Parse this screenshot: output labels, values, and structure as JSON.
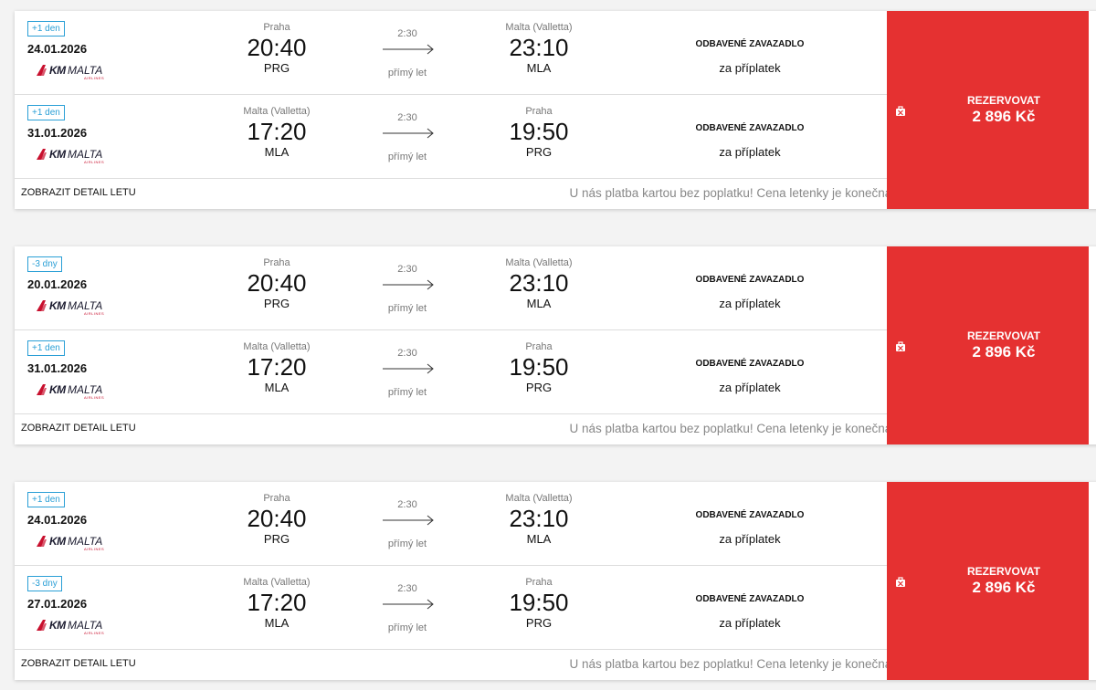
{
  "footer": {
    "detail_link": "ZOBRAZIT DETAIL LETU",
    "payment_note": "U nás platba kartou bez poplatku! Cena letenky je konečná."
  },
  "book": {
    "label": "REZERVOVAT"
  },
  "airline": {
    "brand_bold": "KM",
    "brand_regular": "MALTA",
    "brand_sub": "AIRLINES"
  },
  "colors": {
    "accent_red": "#e53131",
    "badge_blue": "#2a9fd6"
  },
  "results": [
    {
      "price": "2 896 Kč",
      "legs": [
        {
          "badge": "+1 den",
          "date": "24.01.2026",
          "dep_city": "Praha",
          "dep_time": "20:40",
          "dep_code": "PRG",
          "duration": "2:30",
          "stops": "přímý let",
          "arr_city": "Malta (Valletta)",
          "arr_time": "23:10",
          "arr_code": "MLA",
          "baggage_title": "ODBAVENÉ ZAVAZADLO",
          "baggage_value": "za příplatek"
        },
        {
          "badge": "+1 den",
          "date": "31.01.2026",
          "dep_city": "Malta (Valletta)",
          "dep_time": "17:20",
          "dep_code": "MLA",
          "duration": "2:30",
          "stops": "přímý let",
          "arr_city": "Praha",
          "arr_time": "19:50",
          "arr_code": "PRG",
          "baggage_title": "ODBAVENÉ ZAVAZADLO",
          "baggage_value": "za příplatek"
        }
      ]
    },
    {
      "price": "2 896 Kč",
      "legs": [
        {
          "badge": "-3 dny",
          "date": "20.01.2026",
          "dep_city": "Praha",
          "dep_time": "20:40",
          "dep_code": "PRG",
          "duration": "2:30",
          "stops": "přímý let",
          "arr_city": "Malta (Valletta)",
          "arr_time": "23:10",
          "arr_code": "MLA",
          "baggage_title": "ODBAVENÉ ZAVAZADLO",
          "baggage_value": "za příplatek"
        },
        {
          "badge": "+1 den",
          "date": "31.01.2026",
          "dep_city": "Malta (Valletta)",
          "dep_time": "17:20",
          "dep_code": "MLA",
          "duration": "2:30",
          "stops": "přímý let",
          "arr_city": "Praha",
          "arr_time": "19:50",
          "arr_code": "PRG",
          "baggage_title": "ODBAVENÉ ZAVAZADLO",
          "baggage_value": "za příplatek"
        }
      ]
    },
    {
      "price": "2 896 Kč",
      "legs": [
        {
          "badge": "+1 den",
          "date": "24.01.2026",
          "dep_city": "Praha",
          "dep_time": "20:40",
          "dep_code": "PRG",
          "duration": "2:30",
          "stops": "přímý let",
          "arr_city": "Malta (Valletta)",
          "arr_time": "23:10",
          "arr_code": "MLA",
          "baggage_title": "ODBAVENÉ ZAVAZADLO",
          "baggage_value": "za příplatek"
        },
        {
          "badge": "-3 dny",
          "date": "27.01.2026",
          "dep_city": "Malta (Valletta)",
          "dep_time": "17:20",
          "dep_code": "MLA",
          "duration": "2:30",
          "stops": "přímý let",
          "arr_city": "Praha",
          "arr_time": "19:50",
          "arr_code": "PRG",
          "baggage_title": "ODBAVENÉ ZAVAZADLO",
          "baggage_value": "za příplatek"
        }
      ]
    }
  ]
}
